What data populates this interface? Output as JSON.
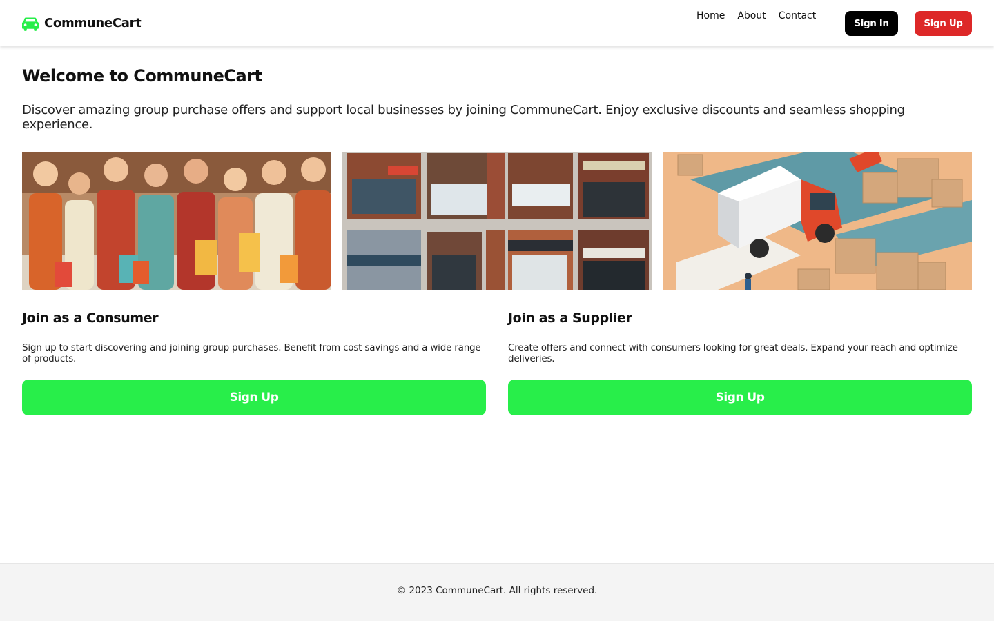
{
  "header": {
    "brand_name": "CommuneCart",
    "brand_icon": "car-icon",
    "nav": [
      {
        "label": "Home"
      },
      {
        "label": "About"
      },
      {
        "label": "Contact"
      }
    ],
    "sign_in_label": "Sign In",
    "sign_up_label": "Sign Up"
  },
  "main": {
    "title": "Welcome to CommuneCart",
    "intro": "Discover amazing group purchase offers and support local businesses by joining CommuneCart. Enjoy exclusive discounts and seamless shopping experience.",
    "cards": [
      {
        "title": "Join as a Consumer",
        "text": "Sign up to start discovering and joining group purchases. Benefit from cost savings and a wide range of products.",
        "button_label": "Sign Up"
      },
      {
        "title": "Join as a Supplier",
        "text": "Create offers and connect with consumers looking for great deals. Expand your reach and optimize deliveries.",
        "button_label": "Sign Up"
      }
    ]
  },
  "footer": {
    "copyright": "© 2023 CommuneCart. All rights reserved."
  },
  "colors": {
    "brand_green": "#28ee4a",
    "sign_up_red": "#dd2828",
    "sign_in_black": "#000000",
    "footer_bg": "#f4f4f4"
  }
}
